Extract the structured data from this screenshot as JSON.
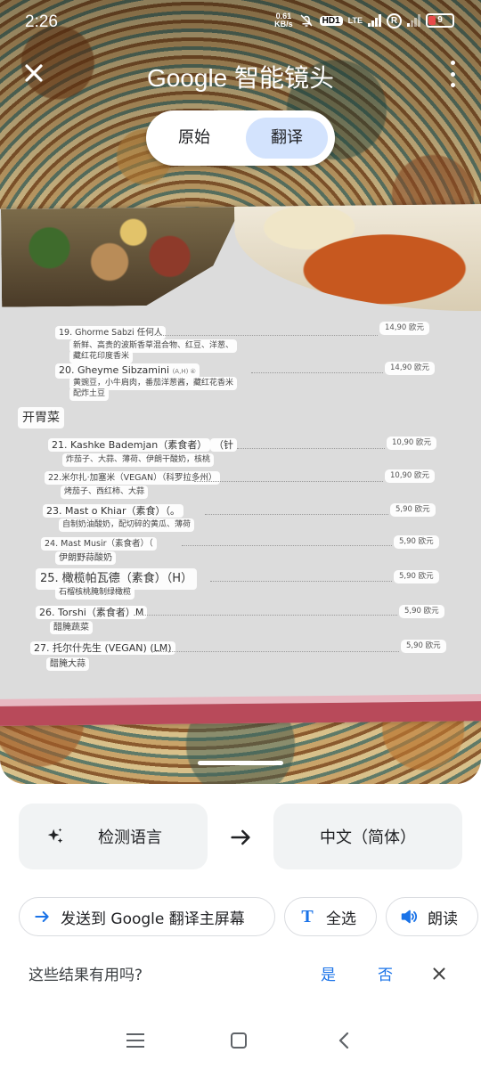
{
  "status_bar": {
    "time": "2:26",
    "net_speed_value": "0.61",
    "net_speed_unit": "KB/s",
    "hd_badge": "HD1",
    "lte_label": "LTE",
    "roaming_badge": "R",
    "battery_level": "9",
    "battery_color": "#e84a4a"
  },
  "header": {
    "title_brand": "Google",
    "title_rest": "智能镜头",
    "close_icon": "close-icon",
    "more_icon": "more-vert-icon"
  },
  "mode_toggle": {
    "options": [
      "原始",
      "翻译"
    ],
    "selected": "翻译",
    "selected_color": "#d3e3fd"
  },
  "menu_overlay": {
    "section_title": "开胃菜",
    "items": [
      {
        "name": "19. Ghorme Sabzi 任何人",
        "desc": "新鲜、高贵的波斯香草混合物、红豆、洋葱、",
        "desc2": "藏红花印度香米",
        "price": "14,90 欧元"
      },
      {
        "name": "20. Gheyme Sibzamini",
        "name_suffix": "(A,H) ④",
        "desc": "黄豌豆，小牛肩肉，番茄洋葱酱，藏红花香米",
        "desc2": "配炸土豆",
        "price": "14,90 欧元"
      },
      {
        "name": "21. Kashke Bademjan（素食者）",
        "name_suffix": "（针",
        "desc": "炸茄子、大蒜、薄荷、伊朗干酸奶，核桃",
        "price": "10,90 欧元"
      },
      {
        "name": "22.米尔扎·加塞米（VEGAN）（科罗拉多州）",
        "desc": "烤茄子、西红柿、大蒜",
        "price": "10,90 欧元"
      },
      {
        "name": "23. Mast o Khiar（素食）（。",
        "desc": "自制奶油酸奶，配切碎的黄瓜、薄荷",
        "price": "5,90 欧元"
      },
      {
        "name": "24. Mast Musir（素食者）（",
        "desc": "伊朗野蒜酸奶",
        "price": "5,90 欧元"
      },
      {
        "name": "25. 橄榄帕瓦德（素食）（H）",
        "desc": "石榴核桃腌制绿橄榄",
        "price": "5,90 欧元"
      },
      {
        "name": "26. Torshi（素食者）M",
        "desc": "醋腌蔬菜",
        "price": "5,90 欧元"
      },
      {
        "name": "27. 托尔什先生 (VEGAN) (LM)",
        "desc": "醋腌大蒜",
        "price": "5,90 欧元"
      }
    ]
  },
  "language_bar": {
    "source_label": "检测语言",
    "source_icon": "sparkle-icon",
    "arrow_icon": "arrow-right-icon",
    "target_label": "中文（简体）"
  },
  "actions": {
    "send_label": "发送到 Google 翻译主屏幕",
    "send_icon": "arrow-right-icon",
    "select_all_label": "全选",
    "select_all_icon": "text-icon",
    "read_label": "朗读",
    "read_icon": "volume-icon",
    "accent_color": "#1a73e8"
  },
  "feedback": {
    "question": "这些结果有用吗?",
    "yes": "是",
    "no": "否"
  },
  "nav_bar": {
    "menu_icon": "menu-icon",
    "home_icon": "home-icon",
    "back_icon": "back-icon"
  }
}
